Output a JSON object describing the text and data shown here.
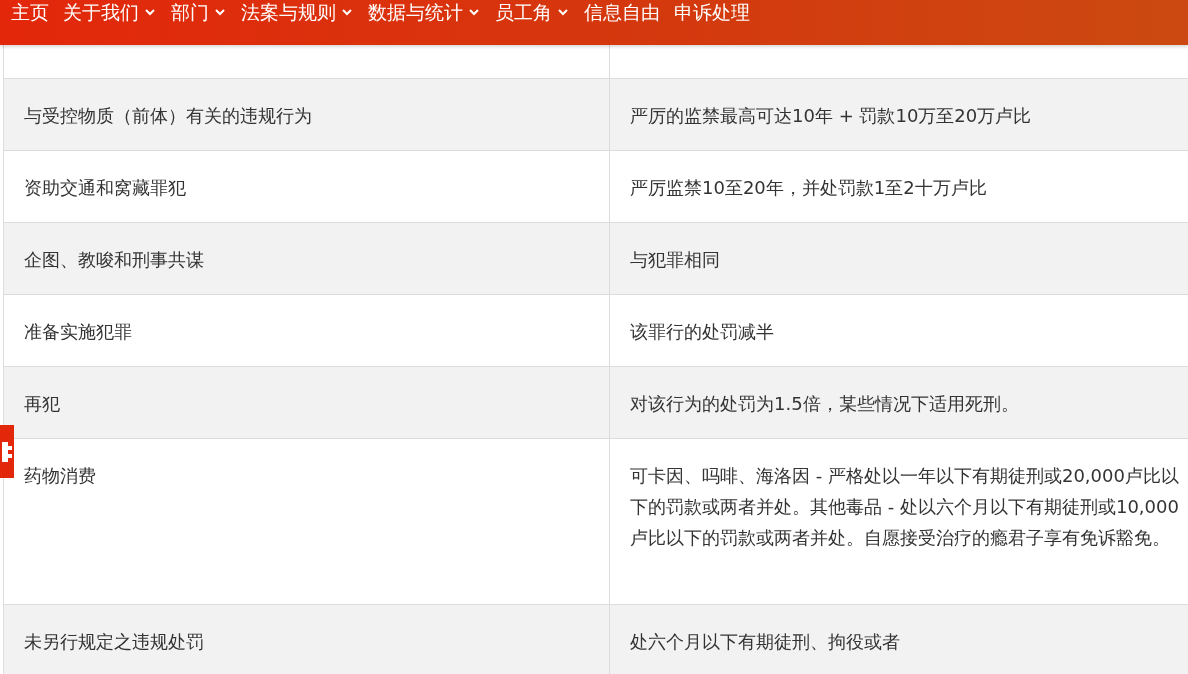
{
  "nav": [
    {
      "label": "主页",
      "dropdown": false
    },
    {
      "label": "关于我们",
      "dropdown": true
    },
    {
      "label": "部门",
      "dropdown": true
    },
    {
      "label": "法案与规则",
      "dropdown": true
    },
    {
      "label": "数据与统计",
      "dropdown": true
    },
    {
      "label": "员工角",
      "dropdown": true
    },
    {
      "label": "信息自由",
      "dropdown": false
    },
    {
      "label": "申诉处理",
      "dropdown": false
    }
  ],
  "table": {
    "rows": [
      {
        "offence": "与受控物质（前体）有关的违规行为",
        "penalty": "严厉的监禁最高可达10年 + 罚款10万至20万卢比"
      },
      {
        "offence": "资助交通和窝藏罪犯",
        "penalty": "严厉监禁10至20年，并处罚款1至2十万卢比"
      },
      {
        "offence": "企图、教唆和刑事共谋",
        "penalty": "与犯罪相同"
      },
      {
        "offence": "准备实施犯罪",
        "penalty": "该罪行的处罚减半"
      },
      {
        "offence": "再犯",
        "penalty": "对该行为的处罚为1.5倍，某些情况下适用死刑。"
      },
      {
        "offence": "药物消费",
        "penalty": "可卡因、吗啡、海洛因 - 严格处以一年以下有期徒刑或20,000卢比以下的罚款或两者并处。其他毒品 - 处以六个月以下有期徒刑或10,000卢比以下的罚款或两者并处。自愿接受治疗的瘾君子享有免诉豁免。"
      },
      {
        "offence": "未另行规定之违规处罚",
        "penalty": "处六个月以下有期徒刑、拘役或者"
      }
    ]
  }
}
